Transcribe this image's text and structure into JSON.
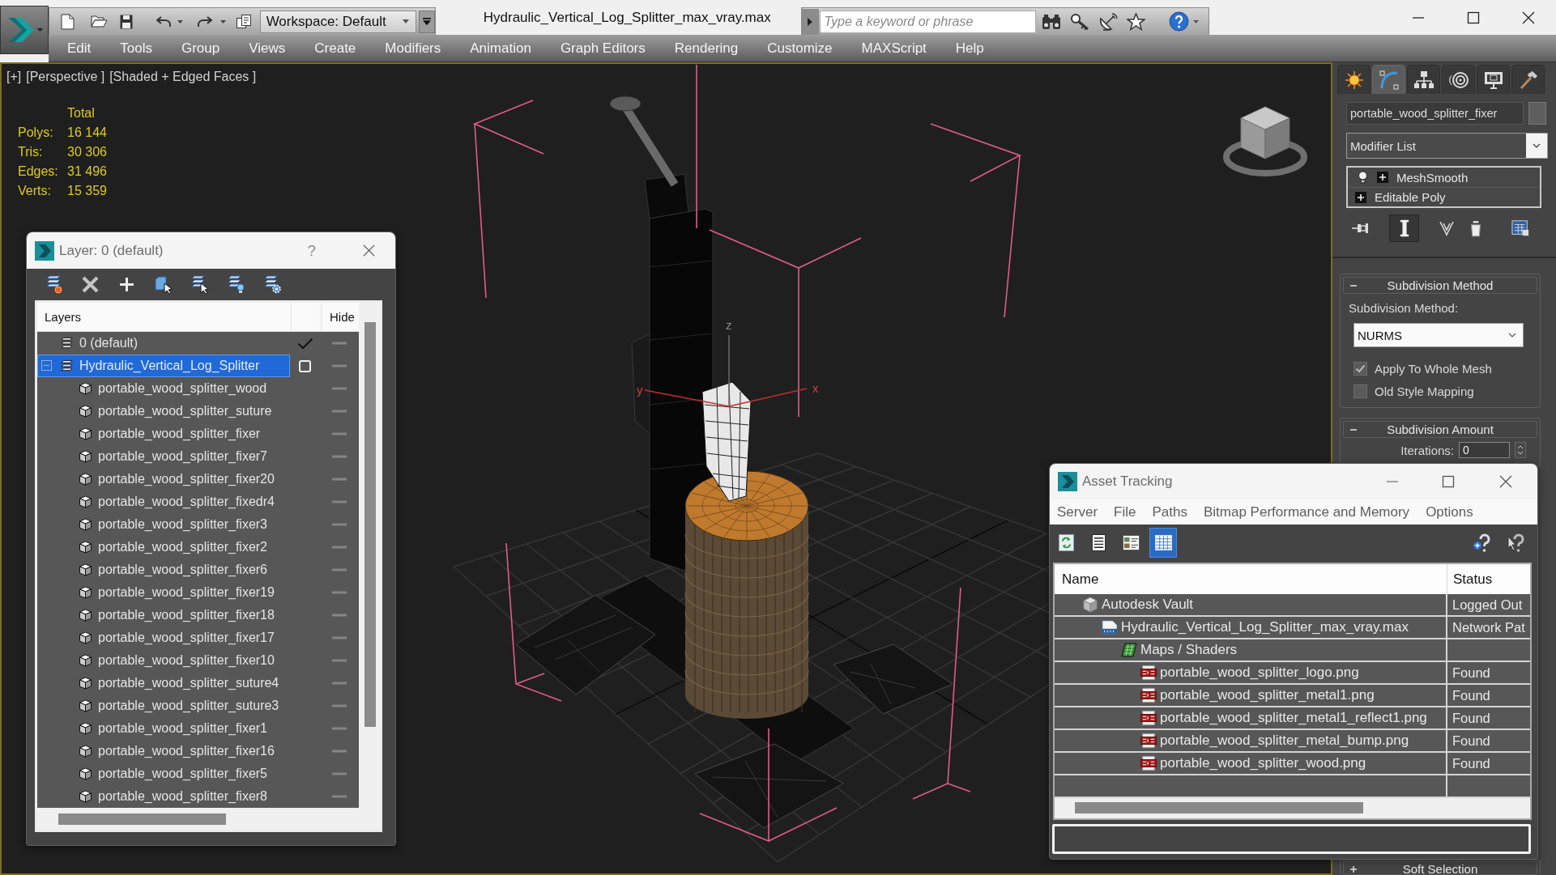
{
  "app": {
    "title": "Hydraulic_Vertical_Log_Splitter_max_vray.max",
    "workspace": "Workspace: Default",
    "search": {
      "placeholder": "Type a keyword or phrase"
    }
  },
  "menu": [
    "Edit",
    "Tools",
    "Group",
    "Views",
    "Create",
    "Modifiers",
    "Animation",
    "Graph Editors",
    "Rendering",
    "Customize",
    "MAXScript",
    "Help"
  ],
  "viewport": {
    "labels": [
      "[+]",
      "[Perspective ]",
      "[Shaded + Edged Faces ]"
    ],
    "stats": {
      "header": "Total",
      "rows": [
        {
          "label": "Polys:",
          "value": "16 144"
        },
        {
          "label": "Tris:",
          "value": "30 306"
        },
        {
          "label": "Edges:",
          "value": "31 496"
        },
        {
          "label": "Verts:",
          "value": "15 359"
        }
      ]
    },
    "gizmo_labels": [
      "z",
      "y",
      "x"
    ]
  },
  "layer_dialog": {
    "title": "Layer: 0 (default)",
    "help": "?",
    "columns": [
      "Layers",
      "Hide"
    ],
    "layers": [
      {
        "name": "0 (default)",
        "current": true,
        "selected": false,
        "hidden": false
      },
      {
        "name": "Hydraulic_Vertical_Log_Splitter",
        "current": false,
        "selected": true,
        "expanded": true,
        "hidden": false,
        "children": [
          {
            "name": "portable_wood_splitter_wood",
            "selected": false,
            "hidden": false
          },
          {
            "name": "portable_wood_splitter_suture",
            "selected": false,
            "hidden": false
          },
          {
            "name": "portable_wood_splitter_fixer",
            "selected": false,
            "hidden": false
          },
          {
            "name": "portable_wood_splitter_fixer7",
            "selected": false,
            "hidden": false
          },
          {
            "name": "portable_wood_splitter_fixer20",
            "selected": false,
            "hidden": false
          },
          {
            "name": "portable_wood_splitter_fixedr4",
            "selected": false,
            "hidden": false
          },
          {
            "name": "portable_wood_splitter_fixer3",
            "selected": false,
            "hidden": false
          },
          {
            "name": "portable_wood_splitter_fixer2",
            "selected": false,
            "hidden": false
          },
          {
            "name": "portable_wood_splitter_fixer6",
            "selected": false,
            "hidden": false
          },
          {
            "name": "portable_wood_splitter_fixer19",
            "selected": false,
            "hidden": false
          },
          {
            "name": "portable_wood_splitter_fixer18",
            "selected": false,
            "hidden": false
          },
          {
            "name": "portable_wood_splitter_fixer17",
            "selected": false,
            "hidden": false
          },
          {
            "name": "portable_wood_splitter_fixer10",
            "selected": false,
            "hidden": false
          },
          {
            "name": "portable_wood_splitter_suture4",
            "selected": false,
            "hidden": false
          },
          {
            "name": "portable_wood_splitter_suture3",
            "selected": false,
            "hidden": false
          },
          {
            "name": "portable_wood_splitter_fixer1",
            "selected": false,
            "hidden": false
          },
          {
            "name": "portable_wood_splitter_fixer16",
            "selected": false,
            "hidden": false
          },
          {
            "name": "portable_wood_splitter_fixer5",
            "selected": false,
            "hidden": false
          },
          {
            "name": "portable_wood_splitter_fixer8",
            "selected": false,
            "hidden": false
          }
        ]
      }
    ]
  },
  "asset_tracking": {
    "title": "Asset Tracking",
    "menu": [
      "Server",
      "File",
      "Paths",
      "Bitmap Performance and Memory",
      "Options"
    ],
    "view_buttons": [
      {
        "selected": false
      },
      {
        "selected": false
      },
      {
        "selected": false
      },
      {
        "selected": true
      }
    ],
    "columns": [
      "Name",
      "Status"
    ],
    "tree": [
      {
        "kind": "vault",
        "name": "Autodesk Vault",
        "status": "Logged Out",
        "children": [
          {
            "kind": "max",
            "name": "Hydraulic_Vertical_Log_Splitter_max_vray.max",
            "status": "Network Pat",
            "children": [
              {
                "kind": "maps",
                "name": "Maps / Shaders",
                "children": [
                  {
                    "kind": "png",
                    "name": "portable_wood_splitter_logo.png",
                    "status": "Found"
                  },
                  {
                    "kind": "png",
                    "name": "portable_wood_splitter_metal1.png",
                    "status": "Found"
                  },
                  {
                    "kind": "png",
                    "name": "portable_wood_splitter_metal1_reflect1.png",
                    "status": "Found"
                  },
                  {
                    "kind": "png",
                    "name": "portable_wood_splitter_metal_bump.png",
                    "status": "Found"
                  },
                  {
                    "kind": "png",
                    "name": "portable_wood_splitter_wood.png",
                    "status": "Found"
                  }
                ]
              }
            ]
          }
        ]
      }
    ]
  },
  "command_panel": {
    "tabs": [
      {
        "selected": false
      },
      {
        "selected": true
      },
      {
        "selected": false
      },
      {
        "selected": false
      },
      {
        "selected": false
      },
      {
        "selected": false
      }
    ],
    "object_name": "portable_wood_splitter_fixer",
    "modifier_list": "Modifier List",
    "stack": [
      {
        "kind": "modifier",
        "name": "MeshSmooth"
      },
      {
        "kind": "base",
        "name": "Editable Poly"
      }
    ],
    "stack_tools": [
      {
        "pressed": false
      },
      {
        "pressed": true
      },
      {
        "pressed": false
      },
      {
        "pressed": false
      },
      {
        "pressed": false
      }
    ],
    "rollouts": [
      {
        "title": "Subdivision Method",
        "expanded": true,
        "controls": [
          {
            "kind": "label",
            "text": "Subdivision Method:"
          },
          {
            "kind": "dropdown",
            "value": "NURMS"
          },
          {
            "kind": "checkbox",
            "label": "Apply To Whole Mesh",
            "checked": true
          },
          {
            "kind": "checkbox",
            "label": "Old Style Mapping",
            "checked": false
          }
        ]
      },
      {
        "title": "Subdivision Amount",
        "expanded": true,
        "controls": [
          {
            "kind": "spinner",
            "label": "Iterations:",
            "value": "0"
          }
        ]
      },
      {
        "title": "Soft Selection",
        "expanded": false
      }
    ]
  }
}
